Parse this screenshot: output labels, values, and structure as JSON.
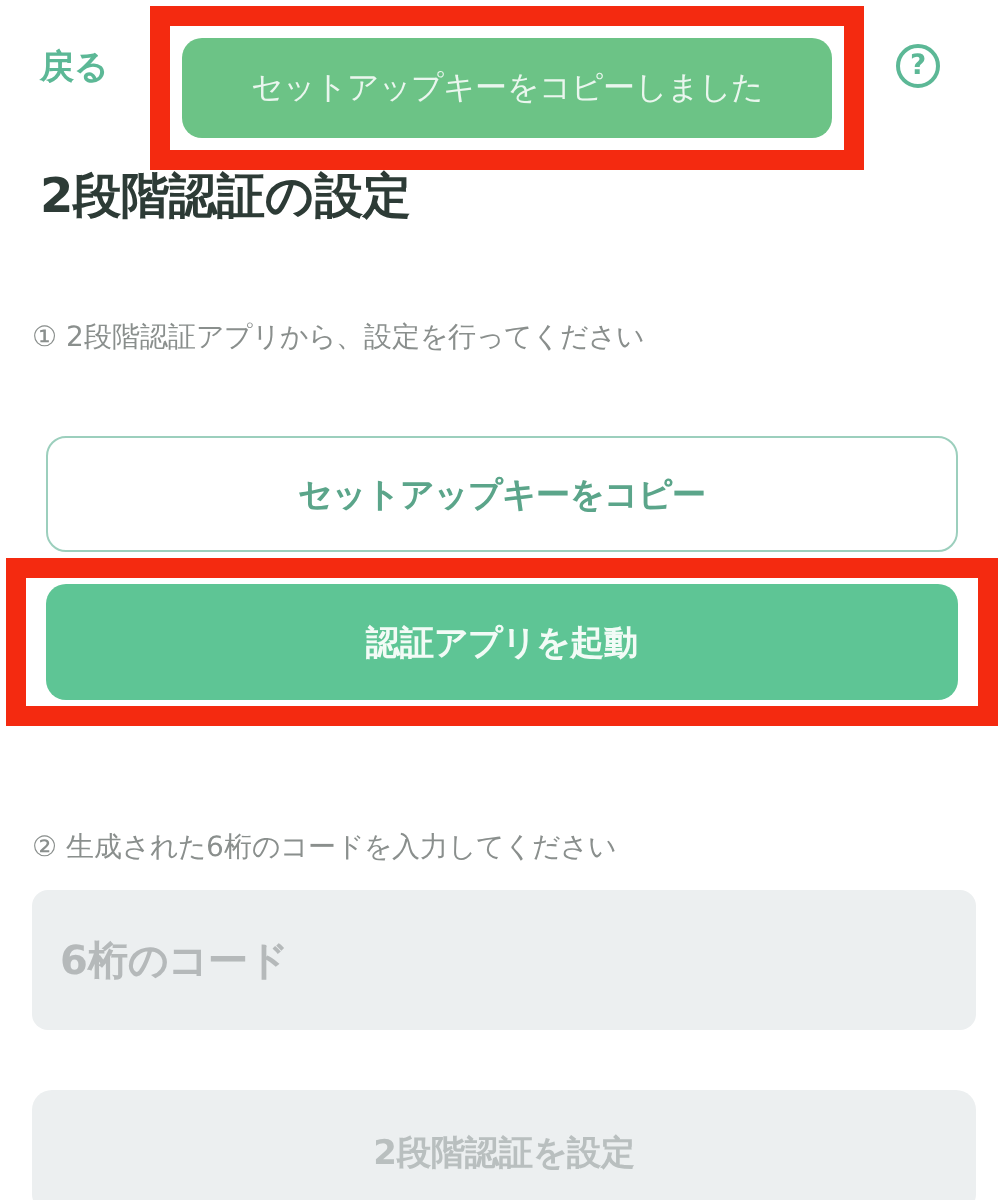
{
  "header": {
    "back_link": "戻る",
    "help_icon": "?"
  },
  "toast": {
    "text": "セットアップキーをコピーしました",
    "highlighted": true
  },
  "title": "2段階認証の設定",
  "step_1": {
    "text": "① 2段階認証アプリから、設定を行ってください"
  },
  "buttons": [
    {
      "label": "セットアップキーをコピー",
      "kind": "outline",
      "highlighted": false
    },
    {
      "label": "認証アプリを起動",
      "kind": "primary",
      "highlighted": true
    }
  ],
  "step_2": {
    "text": "② 生成された6桁のコードを入力してください"
  },
  "code_field": {
    "placeholder": "6桁のコード"
  },
  "submit_button": {
    "label": "2段階認証を設定",
    "disabled": true
  }
}
